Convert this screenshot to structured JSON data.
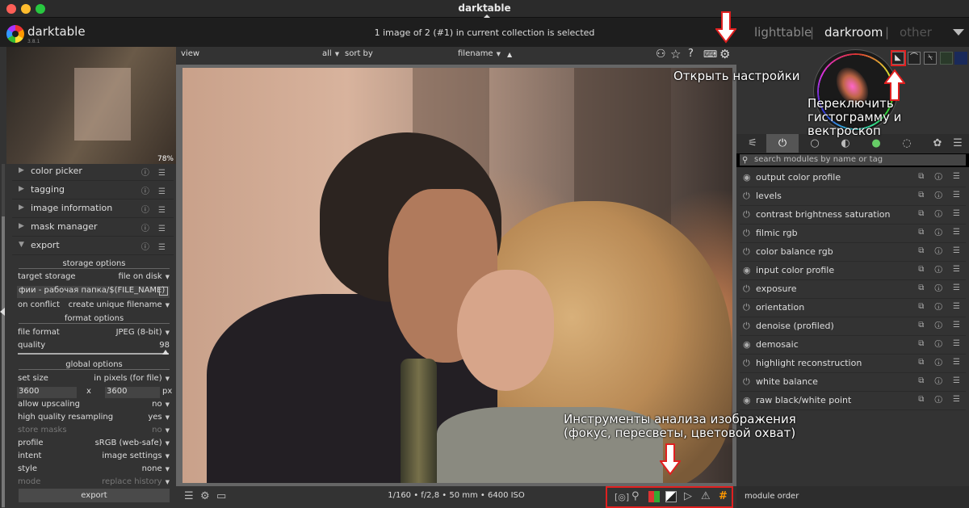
{
  "window": {
    "title": "darktable",
    "traffic_colors": [
      "#ff5f57",
      "#febc2e",
      "#28c840"
    ]
  },
  "header": {
    "brand": "darktable",
    "brand_version": "3.8.1",
    "selection_info": "1 image of 2 (#1) in current collection is selected",
    "views": [
      {
        "label": "lighttable",
        "active": false
      },
      {
        "label": "darkroom",
        "active": true
      },
      {
        "label": "other",
        "active": false
      }
    ],
    "view_separator": "|"
  },
  "left_panel": {
    "thumbnail_zoom": "78%",
    "modules": [
      {
        "label": "color picker",
        "expanded": false
      },
      {
        "label": "tagging",
        "expanded": false
      },
      {
        "label": "image information",
        "expanded": false
      },
      {
        "label": "mask manager",
        "expanded": false
      },
      {
        "label": "export",
        "expanded": true
      }
    ],
    "module_icons": "ⓘ ☰",
    "export": {
      "storage_options_title": "storage options",
      "target_storage_label": "target storage",
      "target_storage_value": "file on disk",
      "path_value": "фии - рабочая папка/$(FILE_NAME)",
      "on_conflict_label": "on conflict",
      "on_conflict_value": "create unique filename",
      "format_options_title": "format options",
      "file_format_label": "file format",
      "file_format_value": "JPEG (8-bit)",
      "quality_label": "quality",
      "quality_value": "98",
      "global_options_title": "global options",
      "set_size_label": "set size",
      "set_size_value": "in pixels (for file)",
      "width_value": "3600",
      "size_x": "x",
      "height_value": "3600",
      "size_unit": "px",
      "allow_upscaling_label": "allow upscaling",
      "allow_upscaling_value": "no",
      "hq_resampling_label": "high quality resampling",
      "hq_resampling_value": "yes",
      "store_masks_label": "store masks",
      "store_masks_value": "no",
      "profile_label": "profile",
      "profile_value": "sRGB (web-safe)",
      "intent_label": "intent",
      "intent_value": "image settings",
      "style_label": "style",
      "style_value": "none",
      "mode_label": "mode",
      "mode_value": "replace history",
      "export_button": "export"
    }
  },
  "center": {
    "view_label": "view",
    "filter_value": "all",
    "sort_by_label": "sort by",
    "sort_value": "filename",
    "sort_dir": "▲",
    "exif": "1/160 • f/2,8 • 50 mm • 6400 ISO"
  },
  "right_panel": {
    "module_groups": [
      "⚟",
      "⏻",
      "○",
      "◐",
      "●",
      "◌",
      "✿"
    ],
    "search_placeholder": "search modules by name or tag",
    "modules": [
      {
        "label": "output color profile",
        "power": "◉"
      },
      {
        "label": "levels",
        "power": "⏻"
      },
      {
        "label": "contrast brightness saturation",
        "power": "⏻"
      },
      {
        "label": "filmic rgb",
        "power": "⏻"
      },
      {
        "label": "color balance rgb",
        "power": "⏻"
      },
      {
        "label": "input color profile",
        "power": "◉"
      },
      {
        "label": "exposure",
        "power": "⏻"
      },
      {
        "label": "orientation",
        "power": "⏻"
      },
      {
        "label": "denoise (profiled)",
        "power": "⏻"
      },
      {
        "label": "demosaic",
        "power": "◉"
      },
      {
        "label": "highlight reconstruction",
        "power": "⏻"
      },
      {
        "label": "white balance",
        "power": "⏻"
      },
      {
        "label": "raw black/white point",
        "power": "◉"
      }
    ],
    "module_icons": "⧉ ⓘ ☰",
    "module_order_label": "module order"
  },
  "annotations": {
    "settings": "Открыть настройки",
    "scope_line1": "Переключить",
    "scope_line2": "гистограмму и вектроскоп",
    "analysis_line1": "Инструменты анализа изображения",
    "analysis_line2": "(фокус, пересветы, цветовой охват)"
  },
  "colors": {
    "annotation_red": "#e02020",
    "panel_bg": "#333333",
    "header_bg": "#1e1e1e"
  }
}
